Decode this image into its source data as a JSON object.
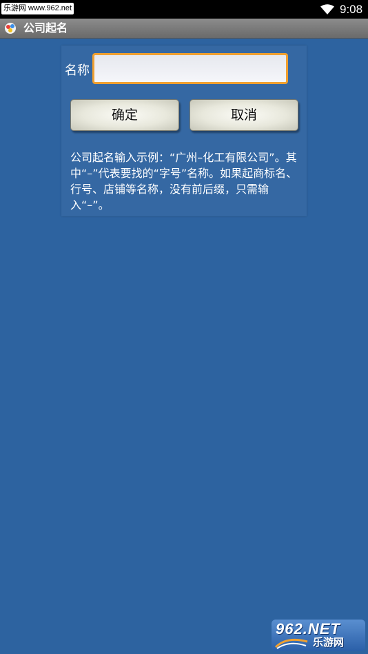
{
  "status_bar": {
    "watermark": "乐游网 www.962.net",
    "time": "9:08",
    "icons": [
      "wifi-icon"
    ]
  },
  "title_bar": {
    "icon": "app-icon",
    "title": "公司起名"
  },
  "form": {
    "name_label": "名称",
    "name_value": "",
    "name_placeholder": "",
    "ok_label": "确定",
    "cancel_label": "取消",
    "hint": "公司起名输入示例：“广州–化工有限公司”。其中“–”代表要找的“字号”名称。如果起商标名、行号、店铺等名称，没有前后缀，只需输入“–”。"
  },
  "logo": {
    "top_text": "962.NET",
    "bottom_text": "乐游网"
  },
  "colors": {
    "background": "#2d63a0",
    "panel": "#3568a3",
    "input_border": "#f0a030",
    "title_bar": "#7a7a7a"
  }
}
